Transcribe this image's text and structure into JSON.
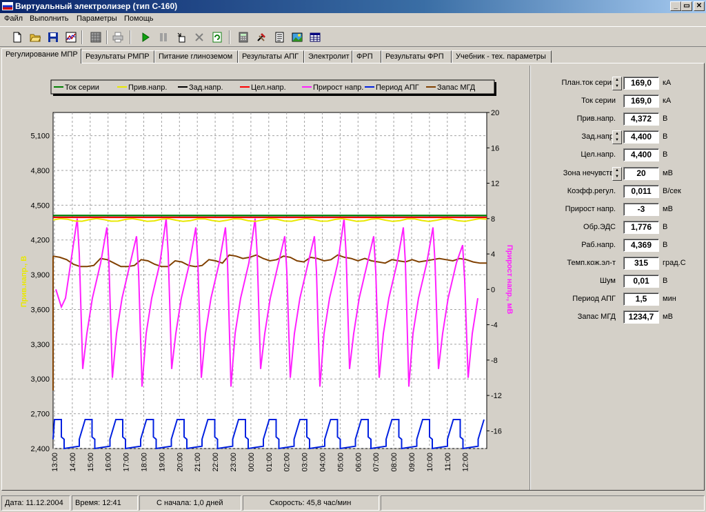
{
  "window": {
    "title": "Виртуальный электролизер (тип С-160)",
    "buttons": {
      "minimize": "_",
      "maximize": "▭",
      "close": "✕"
    }
  },
  "menu": [
    {
      "label": "Файл"
    },
    {
      "label": "Выполнить"
    },
    {
      "label": "Параметры"
    },
    {
      "label": "Помощь"
    }
  ],
  "toolbar": {
    "icons": [
      "new-file-icon",
      "open-folder-icon",
      "save-icon",
      "chart-icon",
      "grid-icon",
      "print-icon",
      "play-icon",
      "pause-icon",
      "step-icon",
      "stop-icon",
      "refresh-icon",
      "calculator-icon",
      "tools-icon",
      "report-icon",
      "image-icon",
      "table-icon"
    ],
    "colors": {
      "play": "#10a010",
      "refresh": "#108010"
    }
  },
  "tabs": [
    {
      "label": "Регулирование МПР",
      "active": true
    },
    {
      "label": "Результаты РМПР"
    },
    {
      "label": "Питание глиноземом"
    },
    {
      "label": "Результаты АПГ"
    },
    {
      "label": "Электролит"
    },
    {
      "label": "ФРП"
    },
    {
      "label": "Результаты ФРП"
    },
    {
      "label": "Учебник - тех. параметры"
    }
  ],
  "chart_data": {
    "type": "line",
    "legend_placement": "top",
    "grid": true,
    "y_left": {
      "label": "Прив.напр., В",
      "ticks": [
        "5,100",
        "4,800",
        "4,500",
        "4,200",
        "3,900",
        "3,600",
        "3,300",
        "3,000",
        "2,700",
        "2,400"
      ],
      "range": [
        2.4,
        5.3
      ],
      "color": "#e8e800"
    },
    "y_right": {
      "label": "Прирост напр., мВ",
      "ticks": [
        "20",
        "16",
        "12",
        "8",
        "4",
        "0",
        "-4",
        "-8",
        "-12",
        "-16"
      ],
      "range": [
        -18,
        20
      ],
      "color": "#ff20ff"
    },
    "x_ticks": [
      "13:00",
      "14:00",
      "15:00",
      "16:00",
      "17:00",
      "18:00",
      "19:00",
      "20:00",
      "21:00",
      "22:00",
      "23:00",
      "00:00",
      "01:00",
      "02:00",
      "03:00",
      "04:00",
      "05:00",
      "06:00",
      "07:00",
      "08:00",
      "09:00",
      "10:00",
      "11:00",
      "12:00"
    ],
    "series": [
      {
        "name": "Ток серии",
        "color": "#008000",
        "value": 4.4
      },
      {
        "name": "Прив.напр.",
        "color": "#e8e800",
        "value": 4.372
      },
      {
        "name": "Зад.напр.",
        "color": "#000000",
        "value": 4.4
      },
      {
        "name": "Цел.напр.",
        "color": "#ff0000",
        "value": 4.4
      },
      {
        "name": "Прирост напр.",
        "color": "#ff20ff"
      },
      {
        "name": "Период АПГ",
        "color": "#0020e0",
        "low": 2.4,
        "mid": 2.48,
        "high": 2.65
      },
      {
        "name": "Запас МГД",
        "color": "#804000",
        "values": [
          4.06,
          4.05,
          4.03,
          3.99,
          3.97,
          3.97,
          3.98,
          4.04,
          4.03,
          4.0,
          3.97,
          3.97,
          3.98,
          4.03,
          4.02,
          3.99,
          3.97,
          3.97,
          4.02,
          4.01,
          3.98,
          3.97,
          3.98,
          4.03,
          4.02,
          4.0,
          4.07,
          4.06,
          4.04,
          4.05,
          4.07,
          4.04,
          4.02,
          4.03,
          4.06,
          4.05,
          4.02,
          4.01,
          4.05,
          4.04,
          4.02,
          4.03,
          4.07,
          4.05,
          4.04,
          4.02,
          4.04,
          4.02,
          4.01,
          4.0,
          4.03,
          4.02,
          4.01,
          4.03,
          4.01,
          4.02,
          4.03,
          4.04,
          4.03,
          4.02,
          4.04,
          4.03,
          4.01,
          4.0,
          4.0
        ]
      },
      {
        "name": "Прирост напр.",
        "peaks_mV": [
          8,
          7,
          6,
          8,
          7,
          7,
          8,
          6,
          6,
          8,
          6,
          7,
          7,
          5,
          6
        ]
      }
    ]
  },
  "params": [
    {
      "label": "План.ток серии",
      "value": "169,0",
      "unit": "кА",
      "spin": true
    },
    {
      "label": "Ток серии",
      "value": "169,0",
      "unit": "кА"
    },
    {
      "label": "Прив.напр.",
      "value": "4,372",
      "unit": "В"
    },
    {
      "label": "Зад.напр.",
      "value": "4,400",
      "unit": "В",
      "spin": true
    },
    {
      "label": "Цел.напр.",
      "value": "4,400",
      "unit": "В"
    },
    {
      "label": "Зона нечувств.",
      "value": "20",
      "unit": "мВ",
      "spin": true
    },
    {
      "label": "Коэфф.регул.",
      "value": "0,011",
      "unit": "В/сек"
    },
    {
      "label": "Прирост напр.",
      "value": "-3",
      "unit": "мВ"
    },
    {
      "label": "Обр.ЭДС",
      "value": "1,776",
      "unit": "В"
    },
    {
      "label": "Раб.напр.",
      "value": "4,369",
      "unit": "В"
    },
    {
      "label": "Темп.кож.эл-т",
      "value": "315",
      "unit": "град.С"
    },
    {
      "label": "Шум",
      "value": "0,01",
      "unit": "В"
    },
    {
      "label": "Период АПГ",
      "value": "1,5",
      "unit": "мин"
    },
    {
      "label": "Запас МГД",
      "value": "1234,7",
      "unit": "мВ"
    }
  ],
  "status": {
    "date": "Дата: 11.12.2004",
    "time": "Время: 12:41",
    "elapsed": "С начала: 1,0 дней",
    "speed": "Скорость: 45,8 час/мин"
  }
}
